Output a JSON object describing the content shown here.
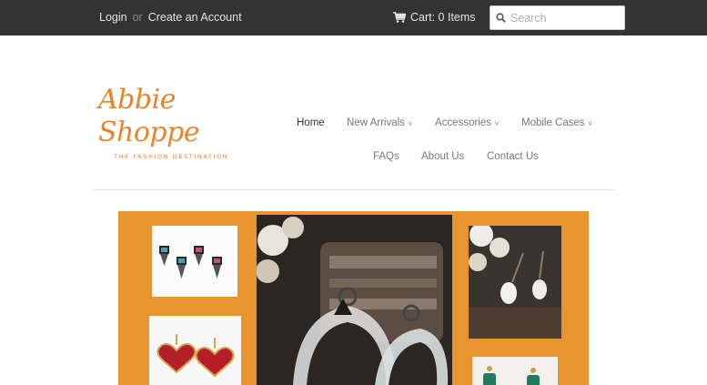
{
  "topbar": {
    "login": "Login",
    "or": "or",
    "create_account": "Create an Account",
    "cart_label": "Cart: 0 Items",
    "search_placeholder": "Search"
  },
  "logo": {
    "name": "Abbie Shoppe",
    "tagline": "THE FASHION DESTINATION"
  },
  "nav": {
    "home": "Home",
    "new_arrivals": "New Arrivals",
    "accessories": "Accessories",
    "mobile_cases": "Mobile Cases",
    "faqs": "FAQs",
    "about_us": "About Us",
    "contact_us": "Contact Us"
  },
  "colors": {
    "topbar_bg": "#333333",
    "brand": "#e8842a",
    "banner_bg": "#e8952f"
  },
  "icons": {
    "cart": "shopping-cart-icon",
    "search": "search-icon",
    "dropdown": "chevron-down-icon"
  }
}
